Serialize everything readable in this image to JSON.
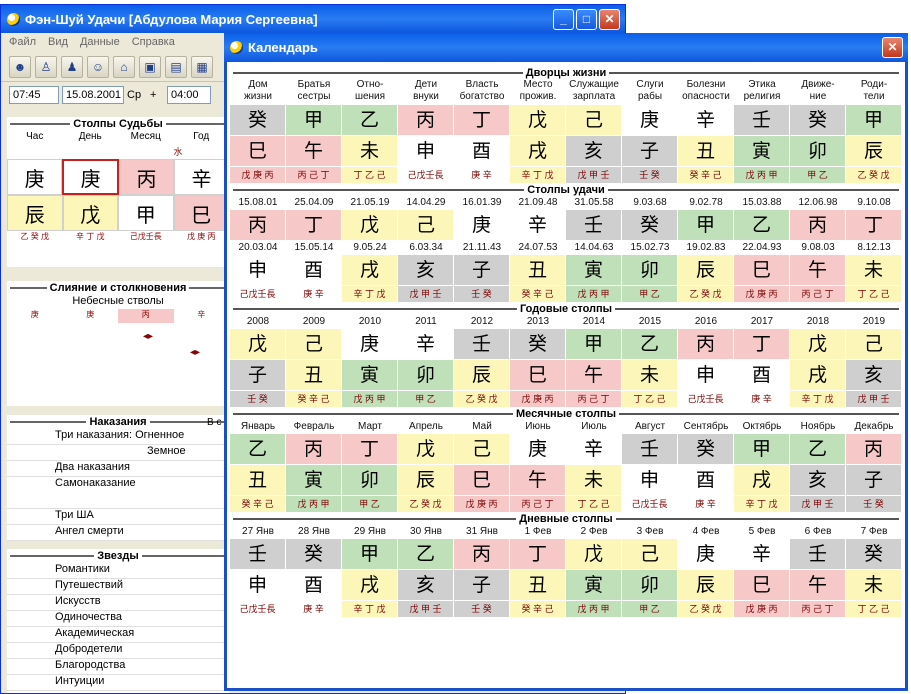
{
  "main": {
    "title": "Фэн-Шуй Удачи [Абдулова Мария Сергеевна]",
    "menu": [
      "Файл",
      "Вид",
      "Данные",
      "Справка"
    ],
    "time": "07:45",
    "date": "15.08.2001",
    "weekday": "Ср",
    "plus": "+",
    "time2": "04:00",
    "fate_title": "Столпы Судьбы",
    "fate_cols": [
      "Час",
      "День",
      "Месяц",
      "Год"
    ],
    "fate_elem": "水",
    "fate_top": [
      "庚",
      "庚",
      "丙",
      "辛"
    ],
    "fate_bot": [
      "辰",
      "戊",
      "甲",
      "巳"
    ],
    "fate_tri": [
      "乙 癸 戊",
      "辛 丁 戊",
      "己戊壬長",
      "戊 庚 丙"
    ],
    "merge_title": "Слияние и столкновения",
    "merge_sub": "Небесные стволы",
    "merge_row": [
      "庚",
      "庚",
      "丙",
      "辛"
    ],
    "pun_title": "Наказания",
    "pun_items": [
      "Три наказания: Огненное",
      "Земное",
      "Два наказания",
      "Самонаказание",
      "Три ША",
      "Ангел смерти"
    ],
    "stars_title": "Звезды",
    "stars_items": [
      "Романтики",
      "Путешествий",
      "Искусств",
      "Одиночества",
      "Академическая",
      "Добродетели",
      "Благородства",
      "Интуиции"
    ],
    "hint": "В с"
  },
  "cal": {
    "title": "Календарь",
    "palaces": {
      "title": "Дворцы жизни",
      "labels": [
        [
          "Дом",
          "жизни"
        ],
        [
          "Братья",
          "сестры"
        ],
        [
          "Отно-",
          "шения"
        ],
        [
          "Дети",
          "внуки"
        ],
        [
          "Власть",
          "богатство"
        ],
        [
          "Место",
          "прожив."
        ],
        [
          "Служащие",
          "зарплата"
        ],
        [
          "Слуги",
          "рабы"
        ],
        [
          "Болезни",
          "опасности"
        ],
        [
          "Этика",
          "религия"
        ],
        [
          "Движе-",
          "ние"
        ],
        [
          "Роди-",
          "тели"
        ]
      ],
      "top": [
        "癸",
        "甲",
        "乙",
        "丙",
        "丁",
        "戊",
        "己",
        "庚",
        "辛",
        "壬",
        "癸",
        "甲"
      ],
      "bot": [
        "巳",
        "午",
        "未",
        "申",
        "酉",
        "戌",
        "亥",
        "子",
        "丑",
        "寅",
        "卯",
        "辰"
      ],
      "tri": [
        "戊 庚 丙",
        "丙 己 丁",
        "丁 乙 己",
        "己戊壬長",
        "庚 辛",
        "辛 丁 戊",
        "戊 甲 壬",
        "壬 癸",
        "癸 辛 己",
        "戊 丙 甲",
        "甲 乙",
        "乙 癸 戊"
      ]
    },
    "luck": {
      "title": "Столпы удачи",
      "d1": [
        "15.08.01",
        "25.04.09",
        "21.05.19",
        "14.04.29",
        "16.01.39",
        "21.09.48",
        "31.05.58",
        "9.03.68",
        "9.02.78",
        "15.03.88",
        "12.06.98",
        "9.10.08"
      ],
      "top": [
        "丙",
        "丁",
        "戊",
        "己",
        "庚",
        "辛",
        "壬",
        "癸",
        "甲",
        "乙",
        "丙",
        "丁"
      ],
      "d2": [
        "20.03.04",
        "15.05.14",
        "9.05.24",
        "6.03.34",
        "21.11.43",
        "24.07.53",
        "14.04.63",
        "15.02.73",
        "19.02.83",
        "22.04.93",
        "9.08.03",
        "8.12.13"
      ],
      "bot": [
        "申",
        "酉",
        "戌",
        "亥",
        "子",
        "丑",
        "寅",
        "卯",
        "辰",
        "巳",
        "午",
        "未"
      ],
      "tri": [
        "己戊壬長",
        "庚 辛",
        "辛 丁 戊",
        "戊 甲 壬",
        "壬 癸",
        "癸 辛 己",
        "戊 丙 甲",
        "甲 乙",
        "乙 癸 戊",
        "戊 庚 丙",
        "丙 己 丁",
        "丁 乙 己"
      ]
    },
    "years": {
      "title": "Годовые столпы",
      "labels": [
        "2008",
        "2009",
        "2010",
        "2011",
        "2012",
        "2013",
        "2014",
        "2015",
        "2016",
        "2017",
        "2018",
        "2019"
      ],
      "top": [
        "戊",
        "己",
        "庚",
        "辛",
        "壬",
        "癸",
        "甲",
        "乙",
        "丙",
        "丁",
        "戊",
        "己"
      ],
      "bot": [
        "子",
        "丑",
        "寅",
        "卯",
        "辰",
        "巳",
        "午",
        "未",
        "申",
        "酉",
        "戌",
        "亥"
      ],
      "tri": [
        "壬 癸",
        "癸 辛 己",
        "戊 丙 甲",
        "甲 乙",
        "乙 癸 戊",
        "戊 庚 丙",
        "丙 己 丁",
        "丁 乙 己",
        "己戊壬長",
        "庚 辛",
        "辛 丁 戊",
        "戊 甲 壬"
      ]
    },
    "months": {
      "title": "Месячные столпы",
      "labels": [
        "Январь",
        "Февраль",
        "Март",
        "Апрель",
        "Май",
        "Июнь",
        "Июль",
        "Август",
        "Сентябрь",
        "Октябрь",
        "Ноябрь",
        "Декабрь"
      ],
      "top": [
        "乙",
        "丙",
        "丁",
        "戊",
        "己",
        "庚",
        "辛",
        "壬",
        "癸",
        "甲",
        "乙",
        "丙"
      ],
      "bot": [
        "丑",
        "寅",
        "卯",
        "辰",
        "巳",
        "午",
        "未",
        "申",
        "酉",
        "戌",
        "亥",
        "子"
      ],
      "tri": [
        "癸 辛 己",
        "戊 丙 甲",
        "甲 乙",
        "乙 癸 戊",
        "戊 庚 丙",
        "丙 己 丁",
        "丁 乙 己",
        "己戊壬長",
        "庚 辛",
        "辛 丁 戊",
        "戊 甲 壬",
        "壬 癸"
      ]
    },
    "days": {
      "title": "Дневные столпы",
      "labels": [
        "27 Янв",
        "28 Янв",
        "29 Янв",
        "30 Янв",
        "31 Янв",
        "1 Фев",
        "2 Фев",
        "3 Фев",
        "4 Фев",
        "5 Фев",
        "6 Фев",
        "7 Фев"
      ],
      "top": [
        "壬",
        "癸",
        "甲",
        "乙",
        "丙",
        "丁",
        "戊",
        "己",
        "庚",
        "辛",
        "壬",
        "癸"
      ],
      "bot": [
        "申",
        "酉",
        "戌",
        "亥",
        "子",
        "丑",
        "寅",
        "卯",
        "辰",
        "巳",
        "午",
        "未"
      ],
      "tri": [
        "己戊壬長",
        "庚 辛",
        "辛 丁 戊",
        "戊 甲 壬",
        "壬 癸",
        "癸 辛 己",
        "戊 丙 甲",
        "甲 乙",
        "乙 癸 戊",
        "戊 庚 丙",
        "丙 己 丁",
        "丁 乙 己"
      ]
    }
  }
}
